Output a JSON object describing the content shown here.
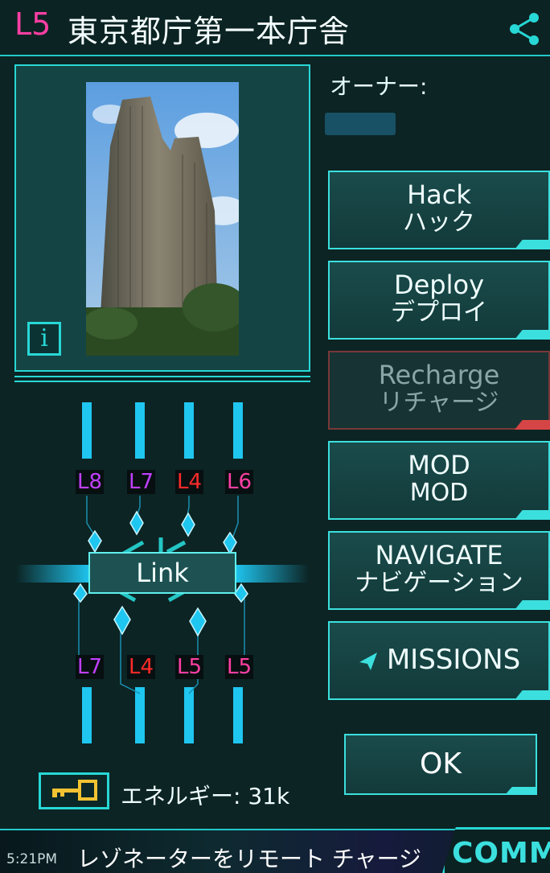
{
  "portal": {
    "level": "L5",
    "title": "東京都庁第一本庁舎"
  },
  "owner": {
    "label": "オーナー:"
  },
  "actions": {
    "hack": {
      "en": "Hack",
      "jp": "ハック"
    },
    "deploy": {
      "en": "Deploy",
      "jp": "デプロイ"
    },
    "recharge": {
      "en": "Recharge",
      "jp": "リチャージ"
    },
    "mod": {
      "en": "MOD",
      "jp": "MOD"
    },
    "navigate": {
      "en": "NAVIGATE",
      "jp": "ナビゲーション"
    },
    "missions": {
      "label": "MISSIONS"
    },
    "ok": "OK"
  },
  "resonators": {
    "top": [
      "L8",
      "L7",
      "L4",
      "L6"
    ],
    "bottom": [
      "L7",
      "L4",
      "L5",
      "L5"
    ],
    "top_colors": [
      "#c040ff",
      "#c040ff",
      "#ff2a2a",
      "#ff3fa4"
    ],
    "bottom_colors": [
      "#c040ff",
      "#ff2a2a",
      "#ff3fa4",
      "#ff3fa4"
    ]
  },
  "link": {
    "label": "Link"
  },
  "energy": {
    "text": "エネルギー: 31k"
  },
  "status": {
    "time": "5:21PM",
    "ticker": "レゾネーターをリモート チャージ"
  },
  "comm": {
    "label": "COMM"
  },
  "colors": {
    "accent": "#3be0de",
    "level_pink": "#ff3fa4",
    "recharge_red": "#d64545"
  },
  "icons": {
    "share": "share-icon",
    "info": "info-icon",
    "key": "key-icon",
    "missions": "paper-plane-icon"
  }
}
